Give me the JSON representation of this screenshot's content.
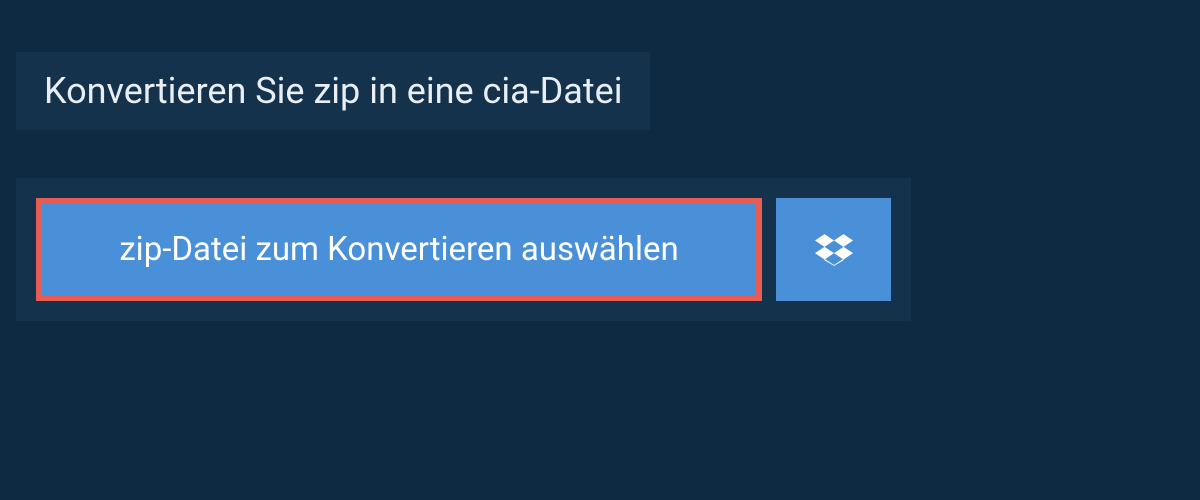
{
  "header": {
    "title": "Konvertieren Sie zip in eine cia-Datei"
  },
  "upload": {
    "select_file_label": "zip-Datei zum Konvertieren auswählen"
  }
}
